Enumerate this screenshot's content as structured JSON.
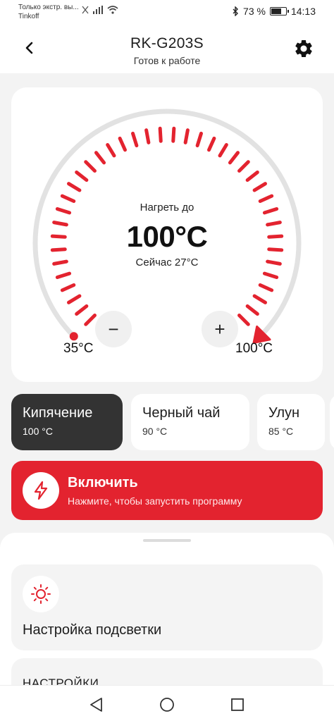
{
  "status_bar": {
    "notification_line1": "Только экстр. вы...",
    "notification_line2": "Tinkoff",
    "battery_percent": "73 %",
    "battery_level": 0.73,
    "time": "14:13"
  },
  "header": {
    "title": "RK-G203S",
    "subtitle": "Готов к работе"
  },
  "dial": {
    "heat_label": "Нагреть до",
    "target_value": "100°C",
    "current_value": "Сейчас 27°C",
    "min_label": "35°C",
    "max_label": "100°C",
    "minus_symbol": "−",
    "plus_symbol": "+",
    "min_temp": 35,
    "max_temp": 100,
    "target_temp": 100,
    "accent_color": "#e3232f",
    "track_color": "#e2e2e2"
  },
  "modes": [
    {
      "name": "Кипячение",
      "temp": "100 °C",
      "active": true
    },
    {
      "name": "Черный чай",
      "temp": "90 °C",
      "active": false
    },
    {
      "name": "Улун",
      "temp": "85 °C",
      "active": false
    }
  ],
  "start_button": {
    "title": "Включить",
    "subtitle": "Нажмите, чтобы запустить программу",
    "icon": "lightning-icon",
    "color": "#e3232f"
  },
  "sheet": {
    "light_settings": {
      "icon": "sun-icon",
      "title": "Настройка подсветки"
    },
    "settings_title": "НАСТРОЙКИ"
  },
  "nav": {
    "back": "triangle-back-icon",
    "home": "circle-home-icon",
    "recents": "square-recents-icon"
  }
}
